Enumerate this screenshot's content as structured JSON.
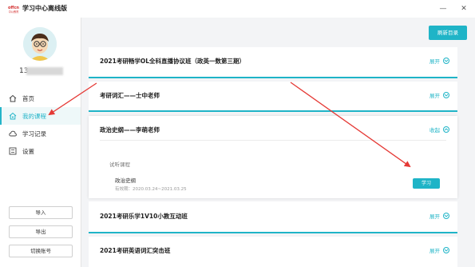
{
  "app": {
    "title": "学习中心离线版",
    "logo_text": "中公教育",
    "minimize": "—",
    "close": "✕"
  },
  "user": {
    "id_prefix": "13"
  },
  "nav": {
    "items": [
      {
        "label": "首页",
        "icon": "home-icon",
        "active": false
      },
      {
        "label": "我的课程",
        "icon": "course-icon",
        "active": true
      },
      {
        "label": "学习记录",
        "icon": "cloud-icon",
        "active": false
      },
      {
        "label": "设置",
        "icon": "settings-icon",
        "active": false
      }
    ]
  },
  "sidebar_buttons": {
    "import": "导入",
    "export": "导出",
    "switch": "切换账号"
  },
  "main": {
    "refresh_label": "刷新目录",
    "courses": [
      {
        "title": "2021考研畅学OL全科直播协议班（政英一数第三期）",
        "toggle": "展开"
      },
      {
        "title": "考研词汇——士中老师",
        "toggle": "展开"
      },
      {
        "title": "政治史纲——李萌老师",
        "toggle": "收起",
        "trial_label": "试听课程",
        "lesson": {
          "name": "政治史纲",
          "validity": "有效期：2020.03.24~2021.03.25",
          "button": "学习"
        }
      },
      {
        "title": "2021考研乐学1V10小教互动班",
        "toggle": "展开"
      },
      {
        "title": "2021考研英语词汇突击班",
        "toggle": "展开"
      }
    ]
  },
  "colors": {
    "accent": "#1fb4c7",
    "arrow": "#e53935"
  }
}
